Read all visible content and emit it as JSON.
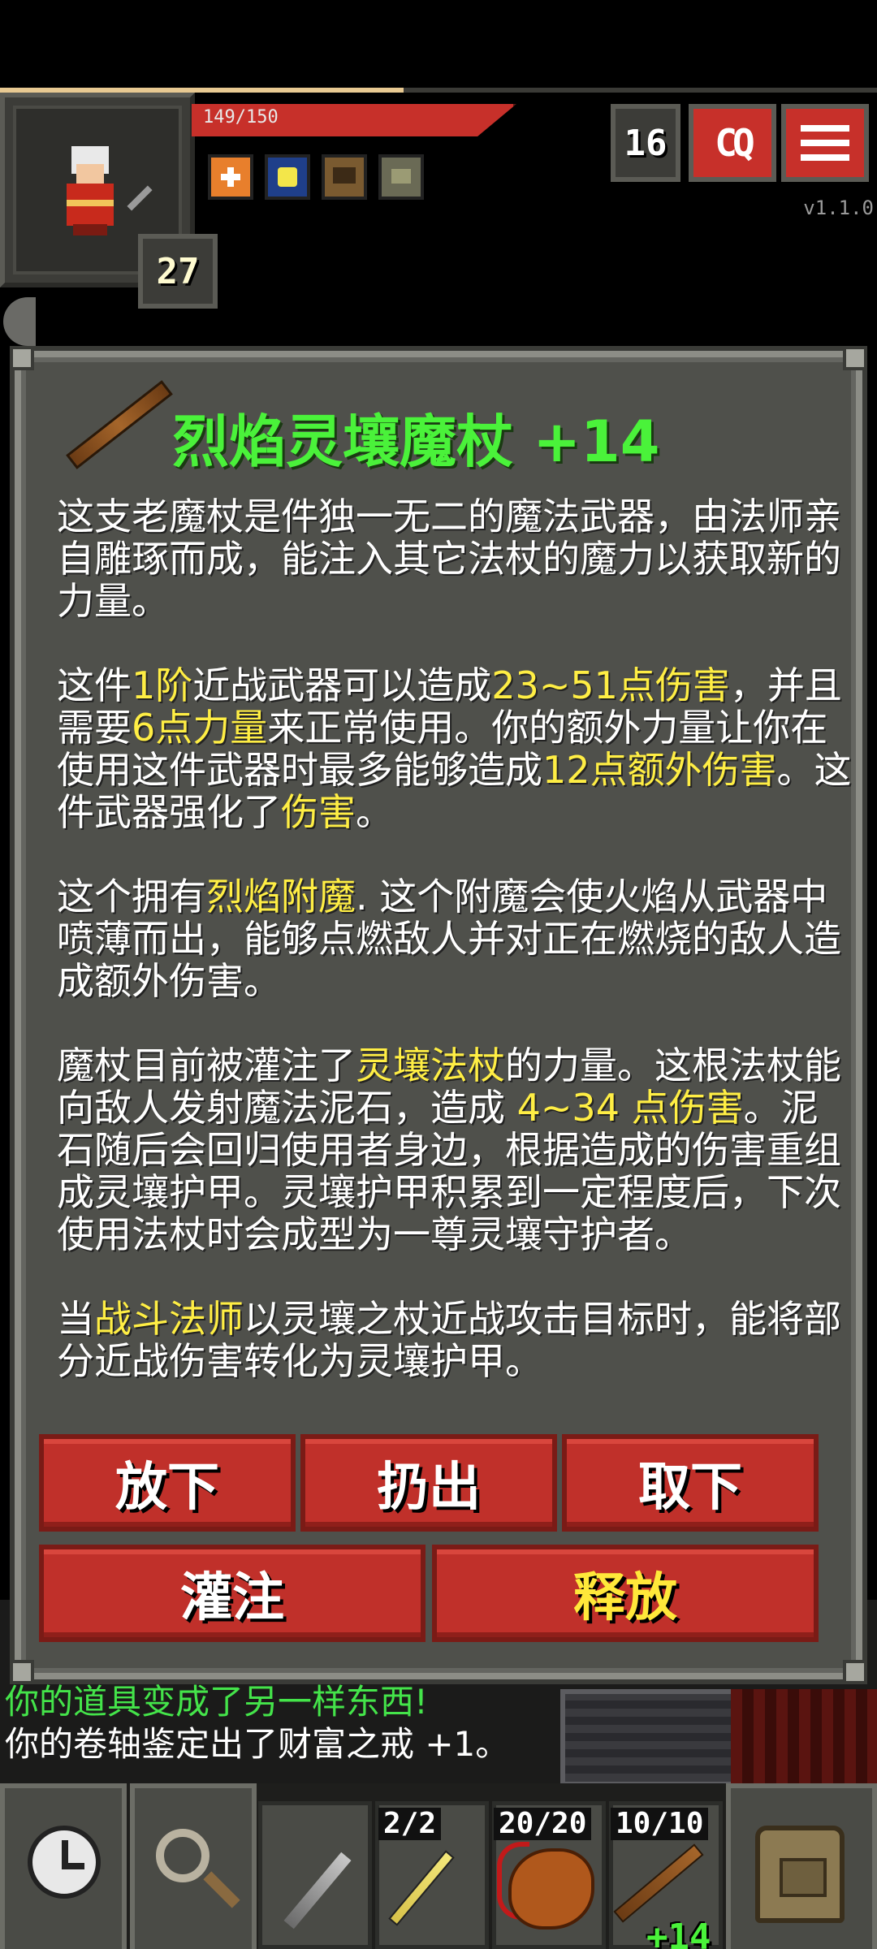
{
  "status": {
    "hp_text": "149/150",
    "hp_fraction": 0.99,
    "xp_fraction": 0.46,
    "hero_level": "27",
    "depth": "16",
    "journal_label": "CQ",
    "version": "v1.1.0",
    "buffs": [
      "heal-buff-icon",
      "light-buff-icon",
      "armor-buff-icon",
      "bless-buff-icon"
    ]
  },
  "item": {
    "title": "烈焰灵壤魔杖 +14",
    "icon": "staff-icon",
    "description": {
      "p1": "这支老魔杖是件独一无二的魔法武器，由法师亲自雕琢而成，能注入其它法杖的魔力以获取新的力量。",
      "p2_a": "这件",
      "p2_tier": "1阶",
      "p2_b": "近战武器可以造成",
      "p2_dmg": "23~51点伤害",
      "p2_c": "，并且需要",
      "p2_str": "6点力量",
      "p2_d": "来正常使用。你的额外力量让你在使用这件武器时最多能够造成",
      "p2_extra": "12点额外伤害",
      "p2_e": "。这件武器强化了",
      "p2_boost": "伤害",
      "p2_f": "。",
      "p3_a": "这个拥有",
      "p3_ench": "烈焰附魔",
      "p3_b": ". 这个附魔会使火焰从武器中喷薄而出，能够点燃敌人并对正在燃烧的敌人造成额外伤害。",
      "p4_a": "魔杖目前被灌注了",
      "p4_wand": "灵壤法杖",
      "p4_b": "的力量。这根法杖能向敌人发射魔法泥石，造成",
      "p4_dmg": " 4~34 点伤害",
      "p4_c": "。泥石随后会回归使用者身边，根据造成的伤害重组成灵壤护甲。灵壤护甲积累到一定程度后，下次使用法杖时会成型为一尊灵壤守护者。",
      "p5_a": "当",
      "p5_class": "战斗法师",
      "p5_b": "以灵壤之杖近战攻击目标时，能将部分近战伤害转化为灵壤护甲。"
    },
    "buttons": {
      "drop": "放下",
      "throw": "扔出",
      "unequip": "取下",
      "imbue": "灌注",
      "zap": "释放"
    }
  },
  "log": {
    "line1": "你的道具变成了另一样东西!",
    "line2": "你的卷轴鉴定出了财富之戒 +1。"
  },
  "quickslots": {
    "wait_icon": "clock-icon",
    "search_icon": "magnifier-icon",
    "slot1_icon": "dagger-icon",
    "slot2_count": "2/2",
    "slot2_icon": "wand-icon",
    "slot3_count": "20/20",
    "slot3_icon": "meat-icon",
    "slot4_count": "10/10",
    "slot4_icon": "staff-icon",
    "slot4_level": "+14",
    "backpack_icon": "backpack-icon"
  },
  "colors": {
    "title": "#4af23a",
    "highlight": "#ffee44",
    "button": "#c0302a",
    "window": "#4f504b"
  }
}
